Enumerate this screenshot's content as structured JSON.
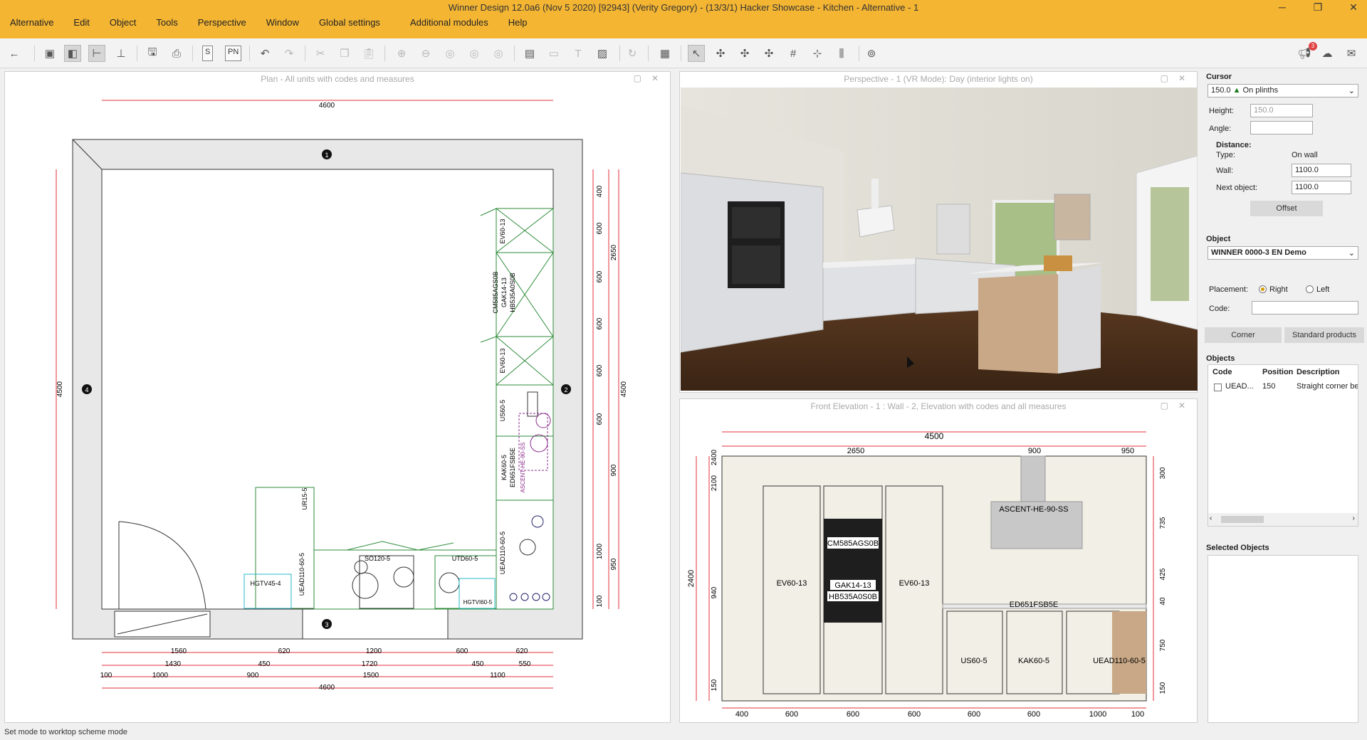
{
  "window": {
    "title": "Winner Design 12.0a6  (Nov 5 2020)  [92943]  (Verity Gregory) - (13/3/1) Hacker Showcase - Kitchen - Alternative - 1",
    "minimize": "─",
    "maximize": "❐",
    "close": "✕"
  },
  "menu": [
    "Alternative",
    "Edit",
    "Object",
    "Tools",
    "Perspective",
    "Window",
    "Global settings",
    "Additional modules",
    "Help"
  ],
  "toolbar": {
    "s_label": "S",
    "pn_label": "PN",
    "notification_count": "3"
  },
  "plan": {
    "title": "Plan - All units with codes and measures",
    "top_dim": "4600",
    "wall_markers": [
      "1",
      "2",
      "3",
      "4"
    ],
    "left_dim": "4500",
    "right_dims_inner": [
      "400",
      "600",
      "600",
      "600",
      "600",
      "600",
      "1000",
      "100"
    ],
    "right_dims_mid": [
      "2650",
      "900",
      "950"
    ],
    "right_dim_outer": "4500",
    "unit_labels": [
      "EV60-13",
      "CM585AGS0B",
      "GAK14-13",
      "HB535A0S0B",
      "EV60-13",
      "US60-5",
      "KAK60-5",
      "ED651FSB5E",
      "ASCENT-HE-90-SS",
      "UEAD110-60-5",
      "UR15-5",
      "UEAD110-60-5",
      "SO120-5",
      "UTD60-5",
      "HGTV45-4",
      "HGTVI60-5"
    ],
    "bottom_dims_row1": [
      "1560",
      "620",
      "1200",
      "600",
      "620"
    ],
    "bottom_dims_row2": [
      "1430",
      "450",
      "1720",
      "450",
      "550"
    ],
    "bottom_dims_row3": [
      "100",
      "1000",
      "900",
      "1500",
      "1100"
    ],
    "bottom_total": "4600"
  },
  "perspective": {
    "title": "Perspective - 1 (VR Mode): Day (interior lights on)"
  },
  "elevation": {
    "title": "Front Elevation - 1 : Wall - 2, Elevation with codes and all measures",
    "total_width": "4500",
    "top_segments": [
      "2650",
      "900",
      "950"
    ],
    "left_outer": "2400",
    "left_inner": [
      "2100",
      "940",
      "150"
    ],
    "left_label": "2400",
    "right_dims": [
      "300",
      "735",
      "425",
      "40",
      "750",
      "150"
    ],
    "unit_labels": [
      "CM585AGS0B",
      "GAK14-13",
      "HB535A0S0B",
      "EV60-13",
      "EV60-13",
      "ASCENT-HE-90-SS",
      "ED651FSB5E",
      "US60-5",
      "KAK60-5",
      "UEAD110-60-5"
    ],
    "bottom_dims": [
      "400",
      "600",
      "600",
      "600",
      "600",
      "600",
      "1000",
      "100"
    ]
  },
  "properties": {
    "cursor_label": "Cursor",
    "cursor_value": "150.0",
    "cursor_mode": "On plinths",
    "height_label": "Height:",
    "height_value": "150.0",
    "angle_label": "Angle:",
    "angle_value": "",
    "distance_label": "Distance:",
    "type_label": "Type:",
    "type_value": "On wall",
    "wall_label": "Wall:",
    "wall_value": "1100.0",
    "next_object_label": "Next object:",
    "next_object_value": "1100.0",
    "offset_button": "Offset",
    "object_label": "Object",
    "object_value": "WINNER 0000-3 EN Demo",
    "placement_label": "Placement:",
    "placement_right": "Right",
    "placement_left": "Left",
    "code_label": "Code:",
    "code_value": "",
    "corner_button": "Corner",
    "standard_button": "Standard products",
    "objects_label": "Objects",
    "objects_columns": [
      "Code",
      "Position",
      "Description"
    ],
    "objects_rows": [
      {
        "code": "UEAD...",
        "position": "150",
        "description": "Straight corner be"
      }
    ],
    "selected_objects_label": "Selected Objects"
  },
  "status": "Set mode to worktop scheme mode",
  "colors": {
    "titlebar": "#f4b533",
    "dim_line": "#e0303a",
    "unit_line": "#2e8b3a"
  }
}
